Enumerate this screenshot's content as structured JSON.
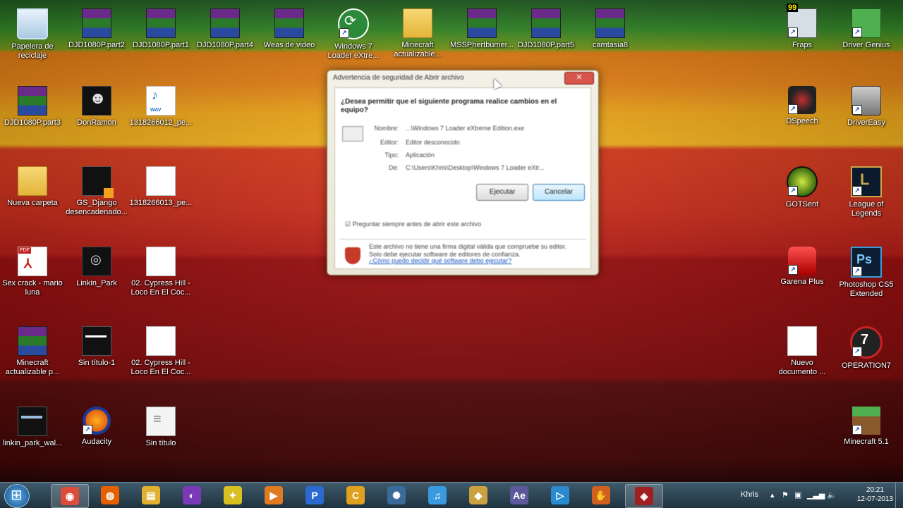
{
  "desktop_icons": [
    {
      "label": "Papelera de\nreciclaje",
      "icon": "recycle-bin-icon"
    },
    {
      "label": "DJD1080P.part2",
      "icon": "winrar-archive-icon"
    },
    {
      "label": "DJD1080P.part1",
      "icon": "winrar-archive-icon"
    },
    {
      "label": "DJD1080P.part4",
      "icon": "winrar-archive-icon"
    },
    {
      "label": "Weas de video",
      "icon": "winrar-archive-icon"
    },
    {
      "label": "Windows 7\nLoader eXtre...",
      "icon": "loader-icon"
    },
    {
      "label": "Minecraft\nactualizable...",
      "icon": "folder-icon"
    },
    {
      "label": "MSSPhertbumer...",
      "icon": "winrar-archive-icon"
    },
    {
      "label": "DJD1080P.part5",
      "icon": "winrar-archive-icon"
    },
    {
      "label": "camtasia8",
      "icon": "winrar-archive-icon"
    },
    {
      "label": "Fraps",
      "icon": "fraps-icon"
    },
    {
      "label": "Driver Genius",
      "icon": "driver-genius-icon"
    },
    {
      "label": "DJD1080P.part3",
      "icon": "winrar-archive-icon"
    },
    {
      "label": "DonRamon",
      "icon": "image-thumbnail-icon"
    },
    {
      "label": "1318266012_pe...",
      "icon": "wav-file-icon"
    },
    {
      "label": "DSpeech",
      "icon": "dspeech-icon"
    },
    {
      "label": "DriverEasy",
      "icon": "drivereasy-icon"
    },
    {
      "label": "Nueva carpeta",
      "icon": "folder-icon"
    },
    {
      "label": "GS_Django\ndesencadenado...",
      "icon": "video-thumbnail-icon"
    },
    {
      "label": "1318266013_pe...",
      "icon": "file-icon"
    },
    {
      "label": "GOTSent",
      "icon": "gotsent-icon"
    },
    {
      "label": "League of\nLegends",
      "icon": "league-of-legends-icon"
    },
    {
      "label": "Sex crack - mario\nluna",
      "icon": "pdf-icon"
    },
    {
      "label": "Linkin_Park",
      "icon": "image-thumbnail-icon"
    },
    {
      "label": "02. Cypress Hill -\nLoco En El Coc...",
      "icon": "file-icon"
    },
    {
      "label": "Garena Plus",
      "icon": "garena-icon"
    },
    {
      "label": "Photoshop CS5\nExtended",
      "icon": "photoshop-icon"
    },
    {
      "label": "Minecraft\nactualizable p...",
      "icon": "winrar-archive-icon"
    },
    {
      "label": "Sin título-1",
      "icon": "image-thumbnail-icon"
    },
    {
      "label": "02. Cypress Hill -\nLoco En El Coc...",
      "icon": "file-icon"
    },
    {
      "label": "Nuevo\ndocumento ...",
      "icon": "file-icon"
    },
    {
      "label": "OPERATION7",
      "icon": "operation7-icon"
    },
    {
      "label": "linkin_park_wal...",
      "icon": "image-thumbnail-icon"
    },
    {
      "label": "Audacity",
      "icon": "audacity-icon"
    },
    {
      "label": "Sin título",
      "icon": "notepad-icon"
    },
    {
      "label": "Minecraft 5.1",
      "icon": "minecraft-icon"
    }
  ],
  "dialog": {
    "title": "Advertencia de seguridad de Abrir archivo",
    "close_label": "✕",
    "question": "¿Desea permitir que el siguiente programa realice cambios en el equipo?",
    "fields": [
      {
        "key": "Nombre:",
        "value": "...\\Windows 7 Loader eXtreme Edition.exe"
      },
      {
        "key": "Editor:",
        "value": "Editor desconocido"
      },
      {
        "key": "Tipo:",
        "value": "Aplicación"
      },
      {
        "key": "De:",
        "value": "C:\\Users\\Khris\\Desktop\\Windows 7 Loader eXtr..."
      }
    ],
    "run_label": "Ejecutar",
    "cancel_label": "Cancelar",
    "checkbox_label": "Preguntar siempre antes de abrir este archivo",
    "warning": "Este archivo no tiene una firma digital válida que compruebe su editor. Solo debe ejecutar software de editores de confianza.",
    "link": "¿Cómo puedo decidir qué software debo ejecutar?"
  },
  "taskbar": {
    "apps": [
      {
        "name": "chrome",
        "glyph": "◉",
        "color": "#dd4b39",
        "active": true
      },
      {
        "name": "firefox",
        "glyph": "◍",
        "color": "#e66000",
        "active": false
      },
      {
        "name": "explorer",
        "glyph": "▤",
        "color": "#e0b030",
        "active": false
      },
      {
        "name": "app-purple",
        "glyph": "◐",
        "color": "#7a3ab8",
        "active": false
      },
      {
        "name": "app-yellow",
        "glyph": "✦",
        "color": "#d8c020",
        "active": false
      },
      {
        "name": "media",
        "glyph": "▶",
        "color": "#e07a20",
        "active": false
      },
      {
        "name": "app-p",
        "glyph": "P",
        "color": "#2a6ad0",
        "active": false
      },
      {
        "name": "camtasia",
        "glyph": "C",
        "color": "#e0a020",
        "active": false
      },
      {
        "name": "atom",
        "glyph": "✺",
        "color": "#3a6a9a",
        "active": false
      },
      {
        "name": "itunes",
        "glyph": "♫",
        "color": "#3a9ae0",
        "active": false
      },
      {
        "name": "app-diamond",
        "glyph": "◆",
        "color": "#caa040",
        "active": false
      },
      {
        "name": "after-effects",
        "glyph": "Ae",
        "color": "#5a5a9a",
        "active": false
      },
      {
        "name": "app-play",
        "glyph": "▷",
        "color": "#2a8ad0",
        "active": false
      },
      {
        "name": "app-glove",
        "glyph": "✋",
        "color": "#d06020",
        "active": false
      },
      {
        "name": "app-active",
        "glyph": "◈",
        "color": "#a02020",
        "active": true
      }
    ],
    "user": "Khris",
    "time": "20:21",
    "date": "12-07-2013"
  }
}
